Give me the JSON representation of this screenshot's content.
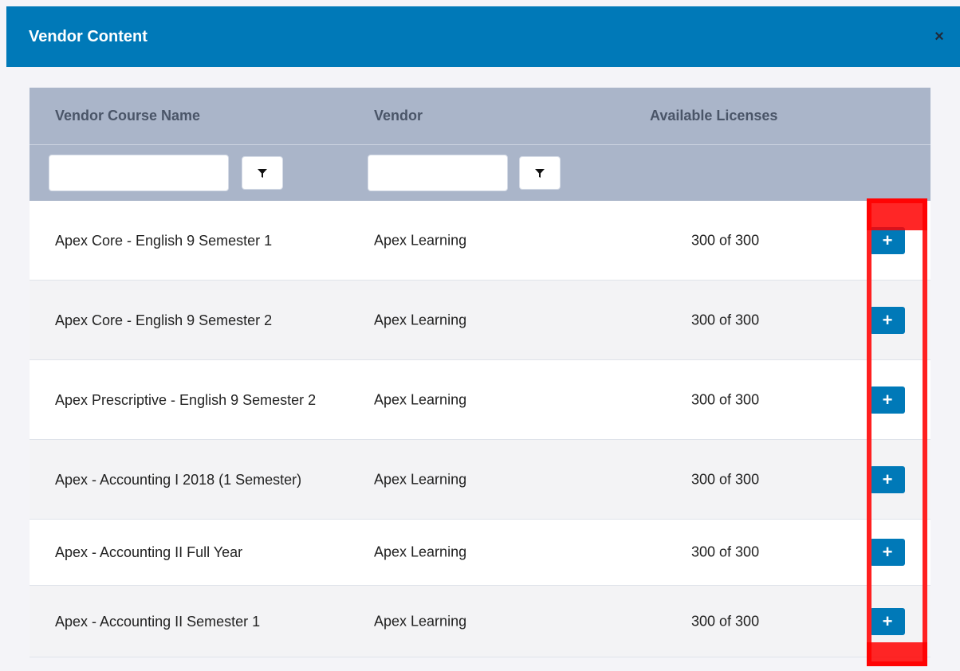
{
  "modal": {
    "title": "Vendor Content",
    "close_label": "×"
  },
  "table": {
    "headers": {
      "course_name": "Vendor Course Name",
      "vendor": "Vendor",
      "licenses": "Available Licenses"
    },
    "filters": {
      "course_name_value": "",
      "vendor_value": ""
    },
    "rows": [
      {
        "name": "Apex Core - English 9 Semester 1",
        "vendor": "Apex Learning",
        "licenses": "300 of 300",
        "action": "+"
      },
      {
        "name": "Apex Core - English 9 Semester 2",
        "vendor": "Apex Learning",
        "licenses": "300 of 300",
        "action": "+"
      },
      {
        "name": "Apex Prescriptive - English 9 Semester 2",
        "vendor": "Apex Learning",
        "licenses": "300 of 300",
        "action": "+"
      },
      {
        "name": "Apex - Accounting I 2018 (1 Semester)",
        "vendor": "Apex Learning",
        "licenses": "300 of 300",
        "action": "+"
      },
      {
        "name": "Apex - Accounting II Full Year",
        "vendor": "Apex Learning",
        "licenses": "300 of 300",
        "action": "+"
      },
      {
        "name": "Apex - Accounting II Semester 1",
        "vendor": "Apex Learning",
        "licenses": "300 of 300",
        "action": "+"
      }
    ]
  },
  "icons": {
    "filter": "filter-icon",
    "close": "close-icon",
    "add": "plus-icon"
  },
  "colors": {
    "header_bg": "#0079b8",
    "grid_header_bg": "#aab5c9",
    "add_button": "#0079b8",
    "highlight": "#ff2020"
  }
}
